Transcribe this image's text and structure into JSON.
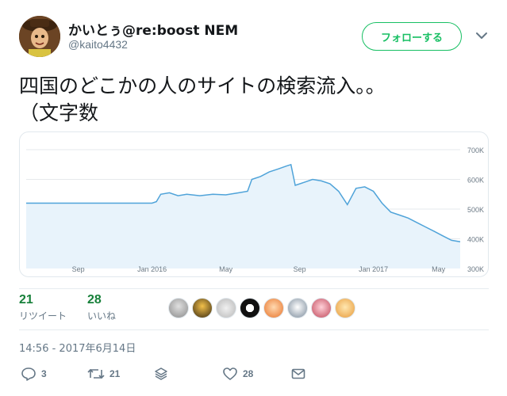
{
  "user": {
    "display_name": "かいとぅ@re:boost NEM",
    "handle": "@kaito4432",
    "follow_label": "フォローする"
  },
  "tweet": {
    "text_line1": "四国のどこかの人のサイトの検索流入。。",
    "text_line2": "（文字数",
    "timestamp": "14:56 - 2017年6月14日"
  },
  "stats": {
    "retweets": {
      "count": "21",
      "label": "リツイート"
    },
    "likes": {
      "count": "28",
      "label": "いいね"
    }
  },
  "actions": {
    "reply_count": "3",
    "retweet_count": "21",
    "like_count": "28"
  },
  "colors": {
    "accent_green": "#17bf63",
    "chart_line": "#4fa3d9",
    "chart_fill": "#e8f3fb"
  },
  "chart_data": {
    "type": "area",
    "y_ticks": [
      "700K",
      "600K",
      "500K",
      "400K",
      "300K"
    ],
    "x_ticks": [
      "Sep",
      "Jan 2016",
      "May",
      "Sep",
      "Jan 2017",
      "May"
    ],
    "ylim": [
      300000,
      700000
    ],
    "grid": true,
    "series": [
      {
        "values": [
          {
            "x": 0.0,
            "y": 520000
          },
          {
            "x": 0.29,
            "y": 520000
          },
          {
            "x": 0.3,
            "y": 525000
          },
          {
            "x": 0.31,
            "y": 550000
          },
          {
            "x": 0.33,
            "y": 555000
          },
          {
            "x": 0.35,
            "y": 545000
          },
          {
            "x": 0.37,
            "y": 550000
          },
          {
            "x": 0.4,
            "y": 545000
          },
          {
            "x": 0.43,
            "y": 550000
          },
          {
            "x": 0.46,
            "y": 548000
          },
          {
            "x": 0.49,
            "y": 555000
          },
          {
            "x": 0.51,
            "y": 560000
          },
          {
            "x": 0.52,
            "y": 600000
          },
          {
            "x": 0.54,
            "y": 610000
          },
          {
            "x": 0.56,
            "y": 625000
          },
          {
            "x": 0.58,
            "y": 635000
          },
          {
            "x": 0.6,
            "y": 645000
          },
          {
            "x": 0.61,
            "y": 650000
          },
          {
            "x": 0.62,
            "y": 580000
          },
          {
            "x": 0.64,
            "y": 590000
          },
          {
            "x": 0.66,
            "y": 600000
          },
          {
            "x": 0.68,
            "y": 595000
          },
          {
            "x": 0.7,
            "y": 585000
          },
          {
            "x": 0.72,
            "y": 560000
          },
          {
            "x": 0.74,
            "y": 515000
          },
          {
            "x": 0.76,
            "y": 570000
          },
          {
            "x": 0.78,
            "y": 575000
          },
          {
            "x": 0.8,
            "y": 560000
          },
          {
            "x": 0.82,
            "y": 520000
          },
          {
            "x": 0.84,
            "y": 490000
          },
          {
            "x": 0.86,
            "y": 480000
          },
          {
            "x": 0.88,
            "y": 470000
          },
          {
            "x": 0.9,
            "y": 455000
          },
          {
            "x": 0.92,
            "y": 440000
          },
          {
            "x": 0.94,
            "y": 425000
          },
          {
            "x": 0.96,
            "y": 410000
          },
          {
            "x": 0.98,
            "y": 395000
          },
          {
            "x": 1.0,
            "y": 390000
          }
        ]
      }
    ]
  }
}
